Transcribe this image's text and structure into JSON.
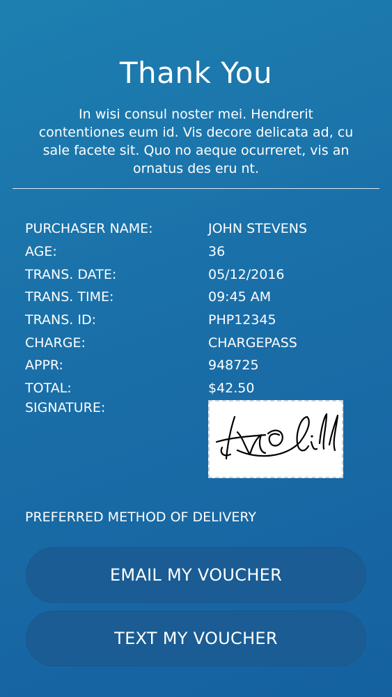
{
  "header": {
    "title": "Thank You",
    "intro": "In wisi consul noster mei. Hendrerit contentiones eum id. Vis decore delicata ad, cu sale facete sit. Quo no aeque ocurreret, vis an ornatus des eru nt."
  },
  "details": [
    {
      "label": "PURCHASER NAME:",
      "value": "JOHN STEVENS"
    },
    {
      "label": "AGE:",
      "value": "36"
    },
    {
      "label": "TRANS. DATE:",
      "value": "05/12/2016"
    },
    {
      "label": "TRANS. TIME:",
      "value": "09:45 AM"
    },
    {
      "label": "TRANS. ID:",
      "value": "PHP12345"
    },
    {
      "label": "CHARGE:",
      "value": "CHARGEPASS"
    },
    {
      "label": "APPR:",
      "value": "948725"
    },
    {
      "label": "TOTAL:",
      "value": "$42.50"
    }
  ],
  "signature": {
    "label": "SIGNATURE:"
  },
  "delivery": {
    "label": "PREFERRED METHOD OF DELIVERY",
    "email_button": "EMAIL MY VOUCHER",
    "text_button": "TEXT MY VOUCHER"
  },
  "colors": {
    "background_top": "#1d7fb0",
    "background_bottom": "#1561a0",
    "button": "#1a5c93",
    "text": "#ffffff"
  }
}
